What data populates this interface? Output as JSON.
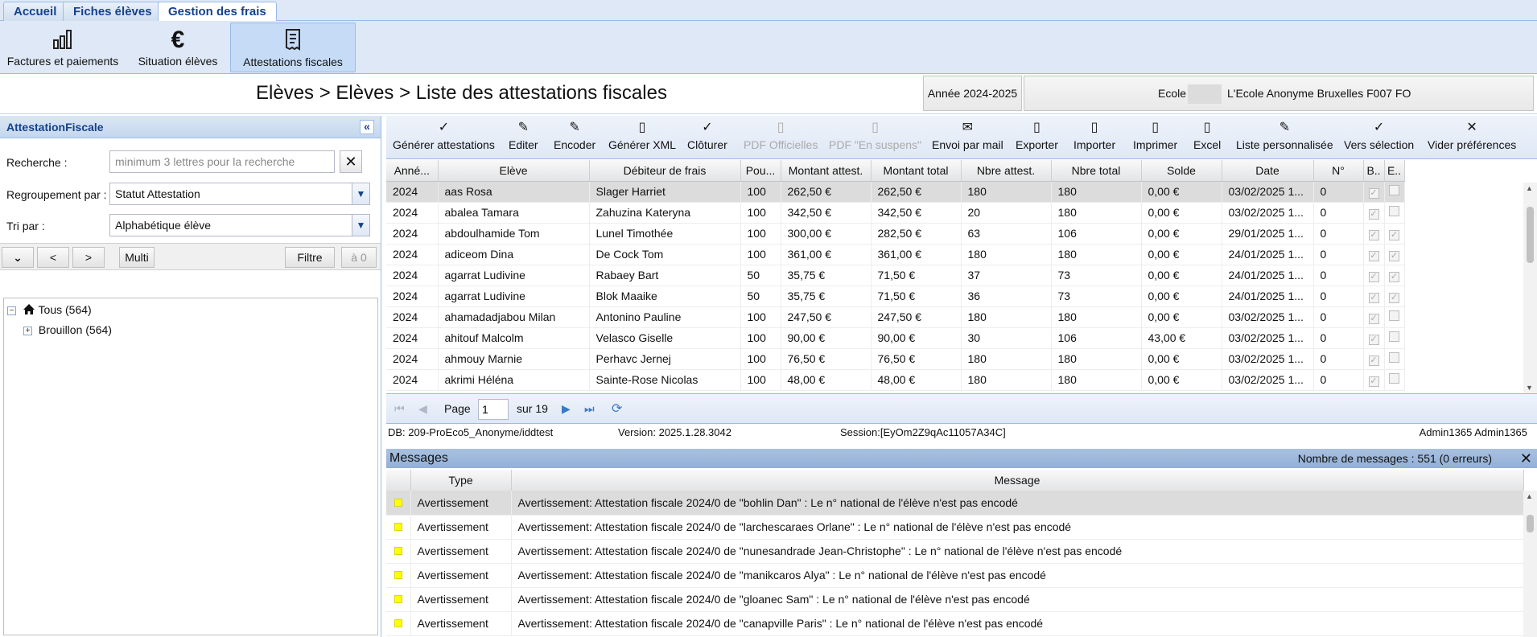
{
  "tabs": [
    {
      "label": "Accueil"
    },
    {
      "label": "Fiches élèves"
    },
    {
      "label": "Gestion des frais",
      "active": true
    }
  ],
  "ribbon": [
    {
      "label": "Factures et paiements",
      "icon": "bar-chart-icon"
    },
    {
      "label": "Situation élèves",
      "icon": "euro-icon"
    },
    {
      "label": "Attestations fiscales",
      "icon": "receipt-icon",
      "active": true
    }
  ],
  "header": {
    "breadcrumb": "Elèves > Elèves > Liste des attestations fiscales",
    "year": "Année 2024-2025",
    "school_label": "Ecole",
    "school_value": "L'Ecole Anonyme Bruxelles F007 FO"
  },
  "left_panel": {
    "title": "AttestationFiscale",
    "search_label": "Recherche :",
    "search_placeholder": "minimum 3 lettres pour la recherche",
    "group_label": "Regroupement par :",
    "group_value": "Statut Attestation",
    "sort_label": "Tri par :",
    "sort_value": "Alphabétique élève",
    "toolbar": {
      "prev": "<",
      "next": ">",
      "multi": "Multi",
      "filter": "Filtre",
      "zero": "à 0"
    },
    "tree": [
      {
        "label": "Tous (564)",
        "icon": "home-icon"
      },
      {
        "label": "Brouillon (564)"
      }
    ]
  },
  "toolbar": [
    {
      "label": "Générer attestations",
      "icon": "check-icon"
    },
    {
      "label": "Editer",
      "icon": "edit-icon"
    },
    {
      "label": "Encoder",
      "icon": "edit-icon"
    },
    {
      "label": "Générer XML",
      "icon": "document-icon"
    },
    {
      "label": "Clôturer",
      "icon": "check-icon"
    },
    {
      "label": "PDF Officielles",
      "icon": "pdf-icon",
      "disabled": true
    },
    {
      "label": "PDF \"En suspens\"",
      "icon": "pdf-icon",
      "disabled": true
    },
    {
      "label": "Envoi par mail",
      "icon": "mail-icon"
    },
    {
      "label": "Exporter",
      "icon": "export-icon"
    },
    {
      "label": "Importer",
      "icon": "import-icon"
    },
    {
      "label": "Imprimer",
      "icon": "print-icon"
    },
    {
      "label": "Excel",
      "icon": "excel-icon"
    },
    {
      "label": "Liste personnalisée",
      "icon": "pencil-icon"
    },
    {
      "label": "Vers sélection",
      "icon": "check-icon"
    },
    {
      "label": "Vider préférences",
      "icon": "close-icon"
    }
  ],
  "grid": {
    "columns": [
      "Anné...",
      "Elève",
      "Débiteur de frais",
      "Pou...",
      "Montant attest.",
      "Montant total",
      "Nbre attest.",
      "Nbre total",
      "Solde",
      "Date",
      "N°",
      "B..",
      "E.."
    ],
    "rows": [
      [
        "2024",
        "aas Rosa",
        "Slager Harriet",
        "100",
        "262,50 €",
        "262,50 €",
        "180",
        "180",
        "0,00 €",
        "03/02/2025 1...",
        "0"
      ],
      [
        "2024",
        "abalea Tamara",
        "Zahuzina Kateryna",
        "100",
        "342,50 €",
        "342,50 €",
        "20",
        "180",
        "0,00 €",
        "03/02/2025 1...",
        "0"
      ],
      [
        "2024",
        "abdoulhamide Tom",
        "Lunel Timothée",
        "100",
        "300,00 €",
        "282,50 €",
        "63",
        "106",
        "0,00 €",
        "29/01/2025 1...",
        "0"
      ],
      [
        "2024",
        "adiceom Dina",
        "De Cock Tom",
        "100",
        "361,00 €",
        "361,00 €",
        "180",
        "180",
        "0,00 €",
        "24/01/2025 1...",
        "0"
      ],
      [
        "2024",
        "agarrat Ludivine",
        "Rabaey Bart",
        "50",
        "35,75 €",
        "71,50 €",
        "37",
        "73",
        "0,00 €",
        "24/01/2025 1...",
        "0"
      ],
      [
        "2024",
        "agarrat Ludivine",
        "Blok Maaike",
        "50",
        "35,75 €",
        "71,50 €",
        "36",
        "73",
        "0,00 €",
        "24/01/2025 1...",
        "0"
      ],
      [
        "2024",
        "ahamadadjabou Milan",
        "Antonino Pauline",
        "100",
        "247,50 €",
        "247,50 €",
        "180",
        "180",
        "0,00 €",
        "03/02/2025 1...",
        "0"
      ],
      [
        "2024",
        "ahitouf Malcolm",
        "Velasco Giselle",
        "100",
        "90,00 €",
        "90,00 €",
        "30",
        "106",
        "43,00 €",
        "03/02/2025 1...",
        "0"
      ],
      [
        "2024",
        "ahmouy Marnie",
        "Perhavc Jernej",
        "100",
        "76,50 €",
        "76,50 €",
        "180",
        "180",
        "0,00 €",
        "03/02/2025 1...",
        "0"
      ],
      [
        "2024",
        "akrimi Héléna",
        "Sainte-Rose Nicolas",
        "100",
        "48,00 €",
        "48,00 €",
        "180",
        "180",
        "0,00 €",
        "03/02/2025 1...",
        "0"
      ]
    ]
  },
  "pager": {
    "page_label": "Page",
    "page_value": "1",
    "of_label": "sur 19"
  },
  "status": {
    "db": "DB: 209-ProEco5_Anonyme/iddtest",
    "version": "Version: 2025.1.28.3042",
    "session": "Session:[EyOm2Z9qAc11057A34C]",
    "user": "Admin1365 Admin1365"
  },
  "messages": {
    "title": "Messages",
    "count": "Nombre de messages : 551 (0 erreurs)",
    "columns": [
      "Type",
      "Message"
    ],
    "rows": [
      [
        "Avertissement",
        "Avertissement: Attestation fiscale 2024/0 de \"bohlin Dan\" : Le n° national de l'élève n'est pas encodé"
      ],
      [
        "Avertissement",
        "Avertissement: Attestation fiscale 2024/0 de \"larchescaraes Orlane\" : Le n° national de l'élève n'est pas encodé"
      ],
      [
        "Avertissement",
        "Avertissement: Attestation fiscale 2024/0 de \"nunesandrade Jean-Christophe\" : Le n° national de l'élève n'est pas encodé"
      ],
      [
        "Avertissement",
        "Avertissement: Attestation fiscale 2024/0 de \"manikcaros Alya\" : Le n° national de l'élève n'est pas encodé"
      ],
      [
        "Avertissement",
        "Avertissement: Attestation fiscale 2024/0 de \"gloanec Sam\" : Le n° national de l'élève n'est pas encodé"
      ],
      [
        "Avertissement",
        "Avertissement: Attestation fiscale 2024/0 de \"canapville Paris\" : Le n° national de l'élève n'est pas encodé"
      ]
    ]
  },
  "colors": {
    "accent": "#15428b",
    "panel": "#dfe8f6",
    "warning": "#ffff00"
  }
}
